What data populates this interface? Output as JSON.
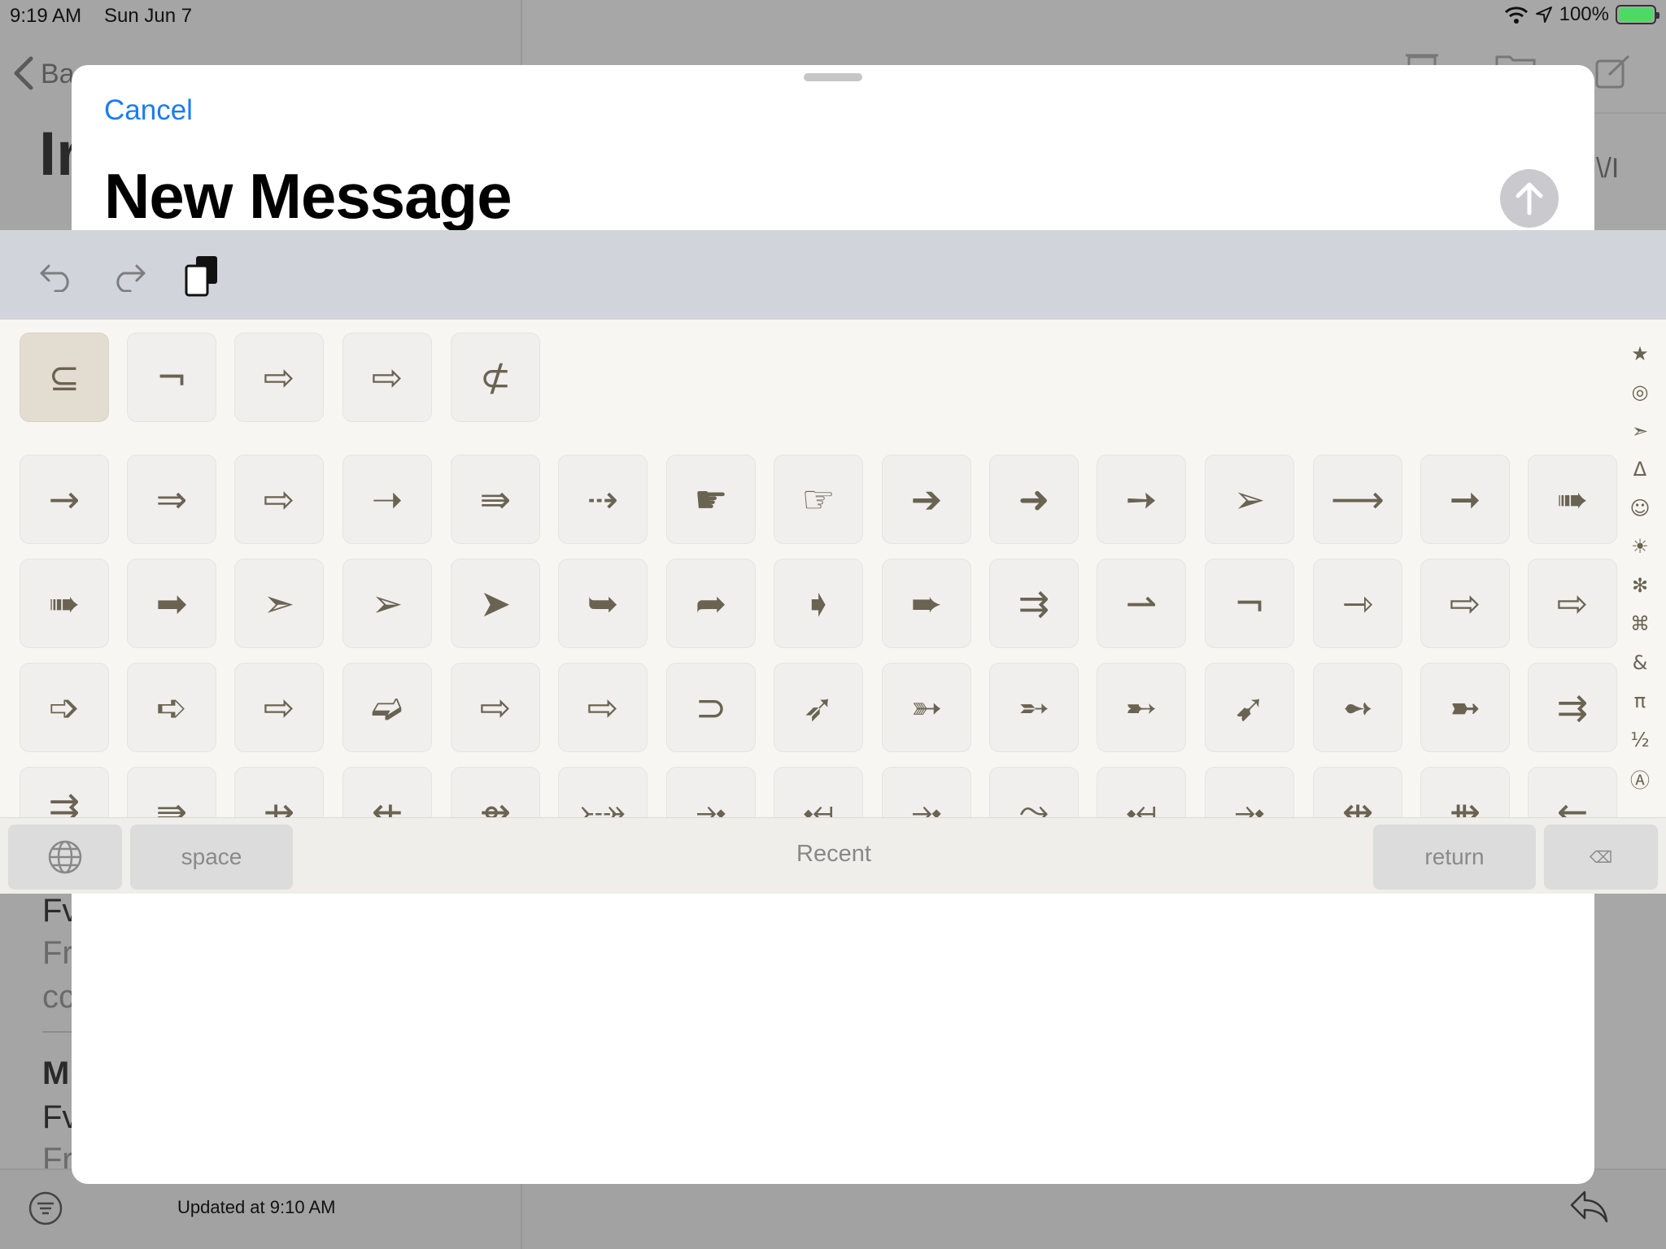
{
  "status_bar": {
    "time": "9:19 AM",
    "date": "Sun Jun 7",
    "battery": "100%",
    "icons": [
      "wifi-icon",
      "location-icon",
      "battery-charging-icon"
    ]
  },
  "background": {
    "back_label": "Ba",
    "inbox_title": "Ir",
    "list_items": [
      {
        "line1": "Fv",
        "line2": "Fr",
        "line3": "cc"
      },
      {
        "line1": "M",
        "line2": "Fv",
        "line3": "Fr"
      }
    ],
    "updated": "Updated at 9:10 AM",
    "side_text": "\\/I"
  },
  "compose": {
    "cancel_label": "Cancel",
    "title": "New Message",
    "send_icon": "arrow-up-icon"
  },
  "keyboard": {
    "shortcut_icons": [
      "undo-icon",
      "redo-icon",
      "paste-icon"
    ],
    "recent_symbols": [
      "⊆",
      "¬",
      "⇨",
      "⇨",
      "⊄"
    ],
    "rows": [
      [
        "→",
        "⇒",
        "⇨",
        "➝",
        "⇛",
        "⇢",
        "☛",
        "☞",
        "➔",
        "➜",
        "➙",
        "➢",
        "⟶",
        "➞",
        "➠"
      ],
      [
        "➠",
        "➡",
        "➣",
        "➢",
        "➤",
        "➥",
        "➦",
        "➧",
        "➨",
        "⇉",
        "⇀",
        "¬",
        "⇾",
        "⇨",
        "⇨"
      ],
      [
        "➩",
        "➪",
        "⇨",
        "➫",
        "⇨",
        "⇨",
        "⊃",
        "➶",
        "➳",
        "➵",
        "➸",
        "➹",
        "➻",
        "➼",
        "⇉"
      ],
      [
        "⇶",
        "⇛",
        "⇸",
        "⇷",
        "⇴",
        "⤐",
        "⤞",
        "⤟",
        "⤞",
        "⤳",
        "⤟",
        "⤞",
        "⇹",
        "⇻",
        "←"
      ]
    ],
    "category_icons": [
      "★",
      "◎",
      "➣",
      "Δ",
      "☺",
      "☀",
      "✻",
      "⌘",
      "&",
      "π",
      "½",
      "Ⓐ"
    ],
    "globe_icon": "globe-icon",
    "space_label": "space",
    "recent_label": "Recent",
    "return_label": "return",
    "delete_icon": "⌫"
  }
}
